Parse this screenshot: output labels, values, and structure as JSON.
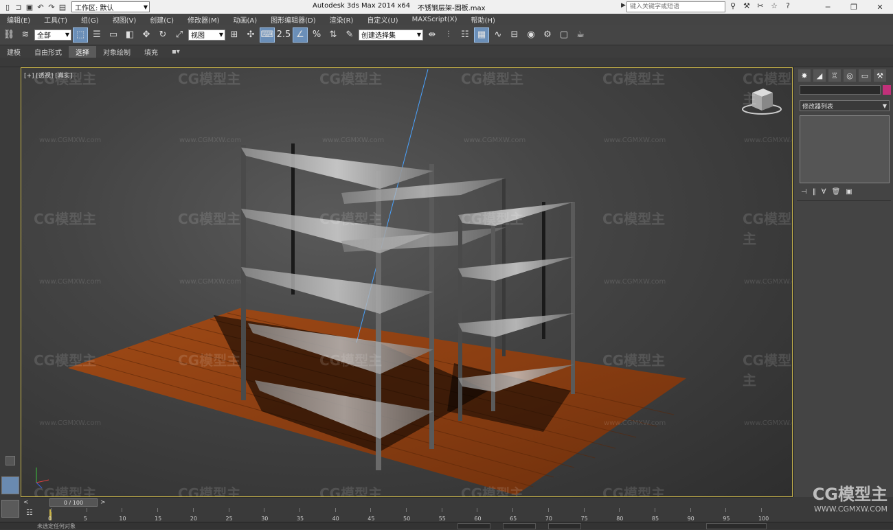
{
  "titlebar": {
    "workspace_label": "工作区: 默认",
    "app_title": "Autodesk 3ds Max  2014 x64",
    "file_name": "不锈钢层架-固板.max",
    "search_placeholder": "键入关键字或短语"
  },
  "menu": [
    "编辑(E)",
    "工具(T)",
    "组(G)",
    "视图(V)",
    "创建(C)",
    "修改器(M)",
    "动画(A)",
    "图形编辑器(D)",
    "渲染(R)",
    "自定义(U)",
    "MAXScript(X)",
    "帮助(H)"
  ],
  "toolbar": {
    "filter_label": "全部",
    "ref_coord_label": "视图",
    "snap_label": "2.5",
    "selection_set_label": "创建选择集"
  },
  "ribbon": {
    "tabs": [
      "建模",
      "自由形式",
      "选择",
      "对象绘制",
      "填充"
    ]
  },
  "viewport": {
    "label": "[+] [透视] [真实]"
  },
  "watermarks": {
    "brand": "CG模型主",
    "url": "www.CGMXW.com",
    "corner_brand": "CG模型主",
    "corner_url": "WWW.CGMXW.COM"
  },
  "command_panel": {
    "modifier_list": "修改器列表"
  },
  "timeline": {
    "frame_display": "0 / 100",
    "ticks": [
      "0",
      "5",
      "10",
      "15",
      "20",
      "25",
      "30",
      "35",
      "40",
      "45",
      "50",
      "55",
      "60",
      "65",
      "70",
      "75",
      "80",
      "85",
      "90",
      "95",
      "100"
    ]
  },
  "status": {
    "text": "未选定任何对象"
  },
  "colors": {
    "viewport_border": "#c8b44a",
    "object_color": "#c2307a",
    "floor": "#8a3e12"
  }
}
